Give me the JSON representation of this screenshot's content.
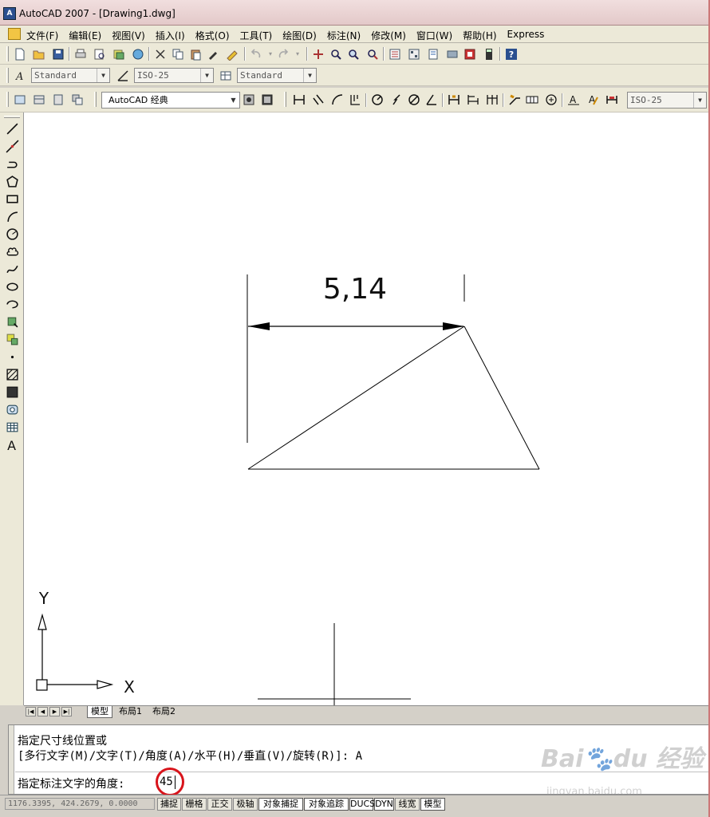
{
  "window": {
    "title": "AutoCAD 2007 - [Drawing1.dwg]"
  },
  "menu": {
    "items": [
      "文件(F)",
      "编辑(E)",
      "视图(V)",
      "插入(I)",
      "格式(O)",
      "工具(T)",
      "绘图(D)",
      "标注(N)",
      "修改(M)",
      "窗口(W)",
      "帮助(H)",
      "Express"
    ]
  },
  "styles_toolbar": {
    "text_style": "Standard",
    "dim_style": "ISO-25",
    "table_style": "Standard"
  },
  "workspace_toolbar": {
    "workspace": "AutoCAD 经典",
    "dim_style_right": "ISO-25"
  },
  "drawing": {
    "dimension_text": "5,14",
    "ucs_x_label": "X",
    "ucs_y_label": "Y"
  },
  "layout_tabs": [
    "模型",
    "布局1",
    "布局2"
  ],
  "command_line": {
    "line1": "指定尺寸线位置或",
    "line2": "[多行文字(M)/文字(T)/角度(A)/水平(H)/垂直(V)/旋转(R)]: A",
    "prompt": "指定标注文字的角度:",
    "input_value": "45"
  },
  "status_bar": {
    "coordinates": "1176.3395, 424.2679, 0.0000",
    "buttons": [
      "捕捉",
      "栅格",
      "正交",
      "极轴",
      "对象捕捉",
      "对象追踪",
      "DUCS",
      "DYN",
      "线宽",
      "模型"
    ]
  },
  "watermark": {
    "logo": "Baidu 经验",
    "url": "jingyan.baidu.com"
  },
  "colors": {
    "accent_circle": "#d8141b",
    "canvas_bg": "#ffffff"
  }
}
